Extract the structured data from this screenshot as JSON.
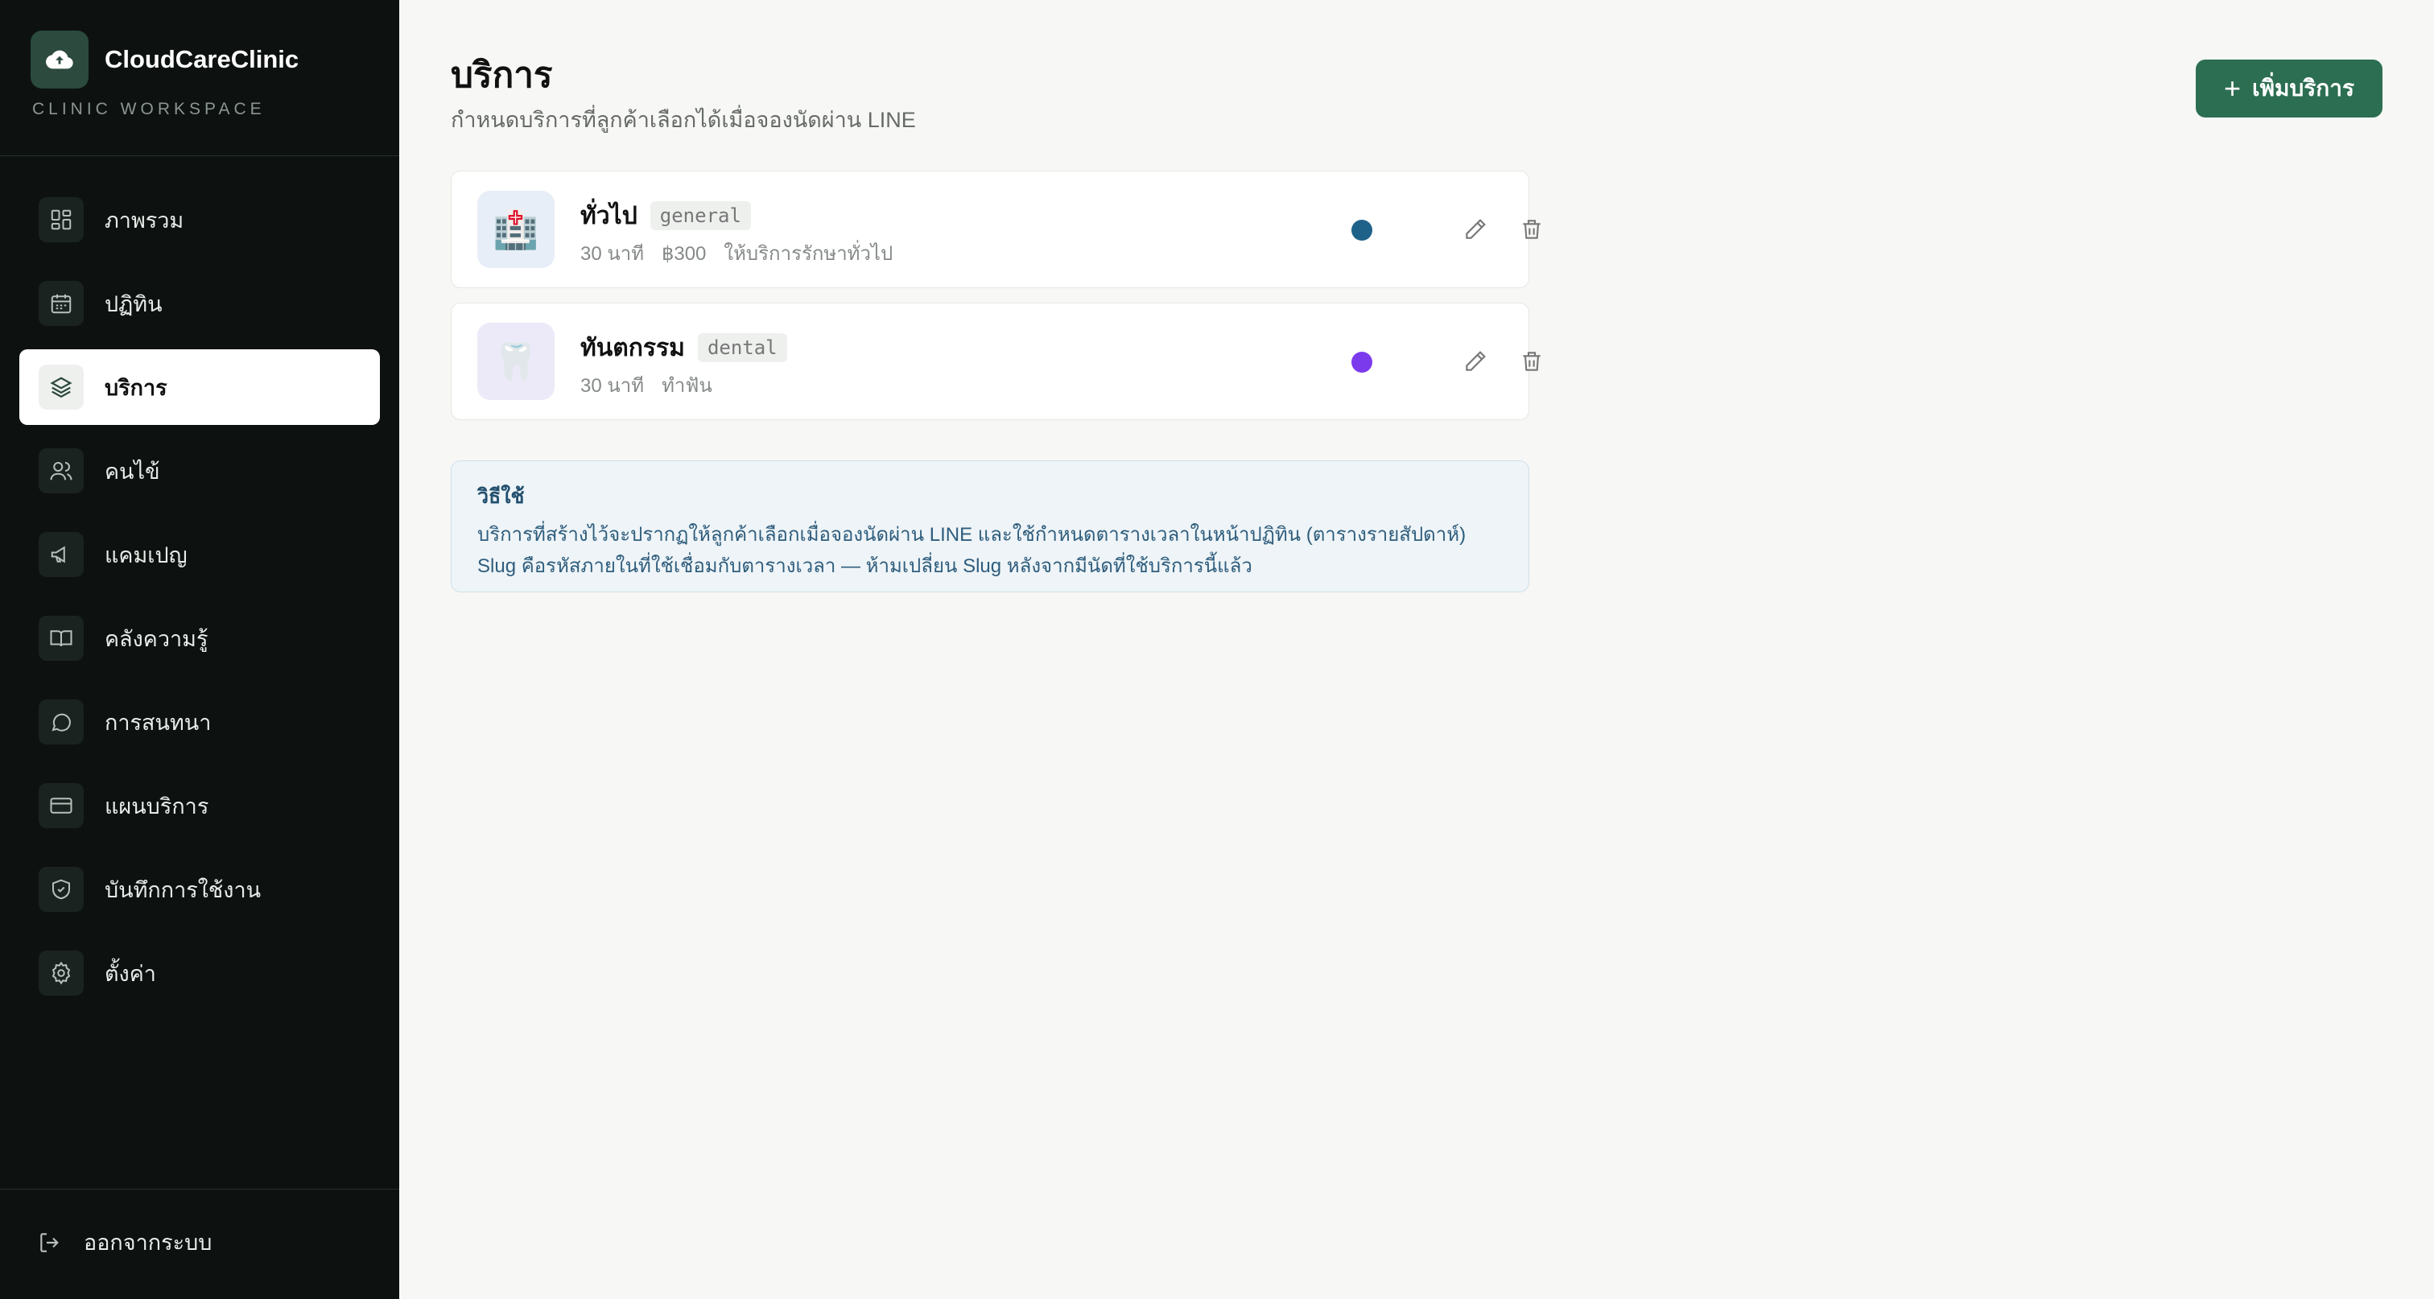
{
  "brand": {
    "name": "CloudCareClinic",
    "subtitle": "CLINIC WORKSPACE"
  },
  "sidebar": {
    "items": [
      {
        "label": "ภาพรวม",
        "icon": "dashboard-icon",
        "active": false
      },
      {
        "label": "ปฏิทิน",
        "icon": "calendar-icon",
        "active": false
      },
      {
        "label": "บริการ",
        "icon": "layers-icon",
        "active": true
      },
      {
        "label": "คนไข้",
        "icon": "users-icon",
        "active": false
      },
      {
        "label": "แคมเปญ",
        "icon": "megaphone-icon",
        "active": false
      },
      {
        "label": "คลังความรู้",
        "icon": "book-icon",
        "active": false
      },
      {
        "label": "การสนทนา",
        "icon": "chat-icon",
        "active": false
      },
      {
        "label": "แผนบริการ",
        "icon": "credit-card-icon",
        "active": false
      },
      {
        "label": "บันทึกการใช้งาน",
        "icon": "shield-icon",
        "active": false
      },
      {
        "label": "ตั้งค่า",
        "icon": "gear-icon",
        "active": false
      }
    ],
    "logout_label": "ออกจากระบบ"
  },
  "header": {
    "title": "บริการ",
    "subtitle": "กำหนดบริการที่ลูกค้าเลือกได้เมื่อจองนัดผ่าน LINE",
    "add_button_label": "เพิ่มบริการ"
  },
  "services": [
    {
      "name": "ทั่วไป",
      "slug": "general",
      "emoji": "🏥",
      "icon_bg": "#e8eef7",
      "meta": [
        "30 นาที",
        "฿300",
        "ให้บริการรักษาทั่วไป"
      ],
      "color": "#1f6289"
    },
    {
      "name": "ทันตกรรม",
      "slug": "dental",
      "emoji": "🦷",
      "icon_bg": "#eceaf8",
      "meta": [
        "30 นาที",
        "ทำฟัน"
      ],
      "color": "#7c3aed"
    }
  ],
  "info": {
    "title": "วิธีใช้",
    "lines": [
      "บริการที่สร้างไว้จะปรากฏให้ลูกค้าเลือกเมื่อจองนัดผ่าน LINE และใช้กำหนดตารางเวลาในหน้าปฏิทิน (ตารางรายสัปดาห์)",
      "Slug คือรหัสภายในที่ใช้เชื่อมกับตารางเวลา — ห้ามเปลี่ยน Slug หลังจากมีนัดที่ใช้บริการนี้แล้ว"
    ]
  }
}
